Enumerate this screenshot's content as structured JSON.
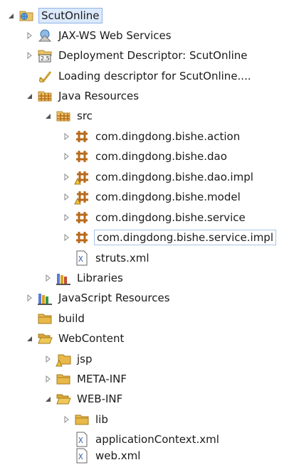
{
  "tree": [
    {
      "label": "ScutOnline",
      "icon": "web-project-icon",
      "expanded": true
    },
    {
      "label": "JAX-WS Web Services",
      "icon": "web-services-icon",
      "expanded": false
    },
    {
      "label": "Deployment Descriptor: ScutOnline",
      "icon": "deployment-descriptor-icon",
      "expanded": false
    },
    {
      "label": "Loading descriptor for ScutOnline....",
      "icon": "loading-icon",
      "expanded": null
    },
    {
      "label": "Java Resources",
      "icon": "java-resources-icon",
      "expanded": true
    },
    {
      "label": "src",
      "icon": "source-folder-icon",
      "expanded": true
    },
    {
      "label": "com.dingdong.bishe.action",
      "icon": "package-icon",
      "expanded": false
    },
    {
      "label": "com.dingdong.bishe.dao",
      "icon": "package-icon",
      "expanded": false
    },
    {
      "label": "com.dingdong.bishe.dao.impl",
      "icon": "package-warning-icon",
      "expanded": false
    },
    {
      "label": "com.dingdong.bishe.model",
      "icon": "package-warning-icon",
      "expanded": false
    },
    {
      "label": "com.dingdong.bishe.service",
      "icon": "package-icon",
      "expanded": false
    },
    {
      "label": "com.dingdong.bishe.service.impl",
      "icon": "package-icon",
      "expanded": false
    },
    {
      "label": "struts.xml",
      "icon": "xml-file-icon",
      "expanded": null
    },
    {
      "label": "Libraries",
      "icon": "libraries-icon",
      "expanded": false
    },
    {
      "label": "JavaScript Resources",
      "icon": "javascript-resources-icon",
      "expanded": false
    },
    {
      "label": "build",
      "icon": "folder-icon",
      "expanded": null
    },
    {
      "label": "WebContent",
      "icon": "folder-open-icon",
      "expanded": true
    },
    {
      "label": "jsp",
      "icon": "folder-warning-icon",
      "expanded": false
    },
    {
      "label": "META-INF",
      "icon": "folder-icon",
      "expanded": false
    },
    {
      "label": "WEB-INF",
      "icon": "folder-open-icon",
      "expanded": true
    },
    {
      "label": "lib",
      "icon": "folder-icon",
      "expanded": false
    },
    {
      "label": "applicationContext.xml",
      "icon": "xml-file-icon",
      "expanded": null
    },
    {
      "label": "web.xml",
      "icon": "xml-file-icon",
      "expanded": null
    }
  ],
  "colors": {
    "selection_bg": "#dbe9fb",
    "selection_border": "#8fb4e6",
    "package": "#b86a1a",
    "folder": "#e8b84a",
    "warning": "#f1c232"
  }
}
